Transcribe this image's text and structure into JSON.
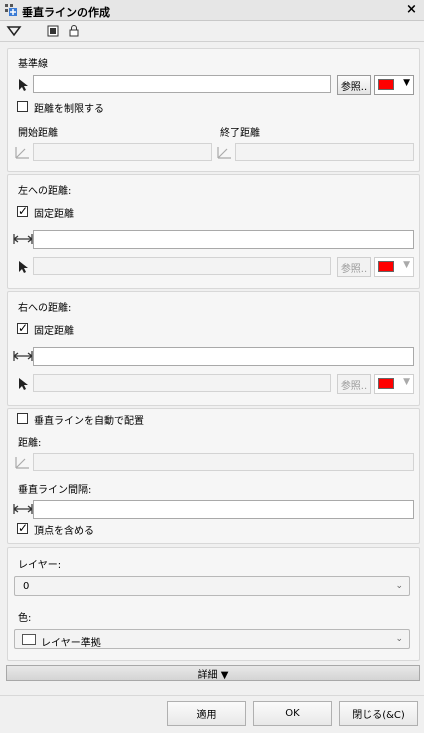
{
  "window": {
    "title": "垂直ラインの作成",
    "close_label": "×"
  },
  "baseline": {
    "section_label": "基準線",
    "browse_label": "参照..",
    "restrict_label": "距離を制限する",
    "start_label": "開始距離",
    "end_label": "終了距離",
    "color": "#ff0000"
  },
  "left": {
    "section_label": "左への距離:",
    "fixed_label": "固定距離",
    "browse_label": "参照..",
    "color": "#ff0000"
  },
  "right": {
    "section_label": "右への距離:",
    "fixed_label": "固定距離",
    "browse_label": "参照..",
    "color": "#ff0000"
  },
  "auto": {
    "auto_label": "垂直ラインを自動で配置",
    "distance_label": "距離:",
    "interval_label": "垂直ライン間隔:",
    "include_vertices_label": "頂点を含める"
  },
  "layer": {
    "label": "レイヤー:",
    "value": "0",
    "color_label": "色:",
    "color_value": "レイヤー準拠"
  },
  "details_label": "詳細 ▼",
  "footer": {
    "apply_label": "適用",
    "ok_label": "OK",
    "close_label": "閉じる(&C)"
  }
}
